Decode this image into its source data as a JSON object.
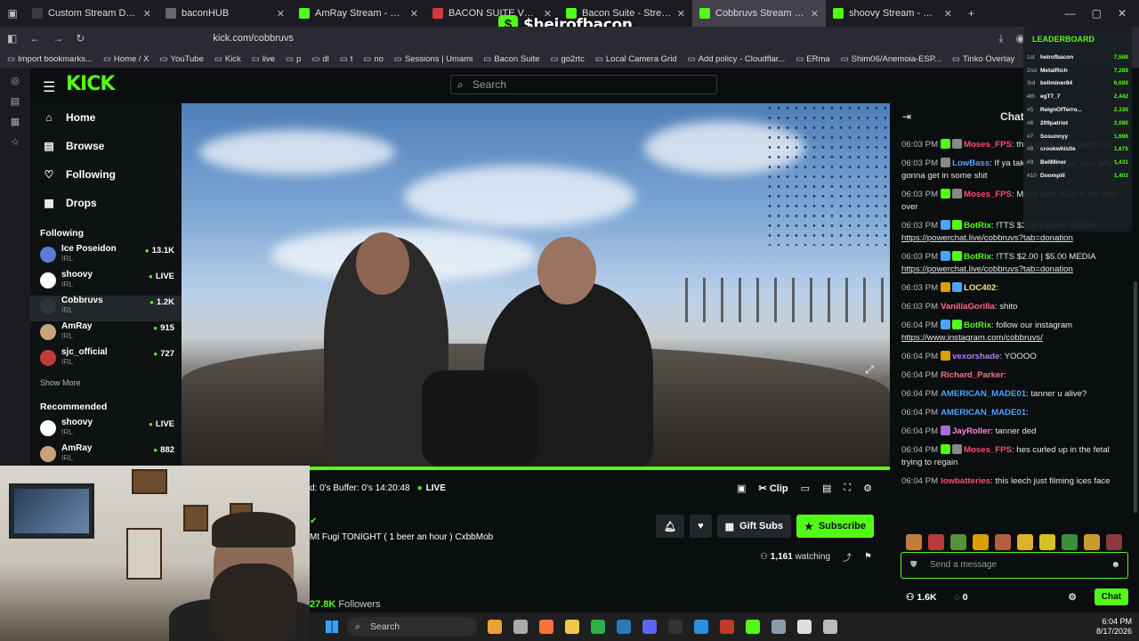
{
  "browser": {
    "tabs": [
      {
        "title": "Custom Stream Deck",
        "color": "#3b3a44"
      },
      {
        "title": "baconHUB",
        "color": "#666"
      },
      {
        "title": "AmRay Stream - Watch Live on",
        "color": "#53fc18"
      },
      {
        "title": "BACON SUITE V4 // COMMAND",
        "color": "#d23b3b"
      },
      {
        "title": "Bacon Suite - Stream - Watc",
        "color": "#53fc18"
      },
      {
        "title": "Cobbruvs Stream - Watch Live o",
        "color": "#53fc18"
      },
      {
        "title": "shoovy Stream - Watch Live on",
        "color": "#53fc18"
      }
    ],
    "url": "kick.com/cobbruvs",
    "bookmarks": [
      "Import bookmarks...",
      "Home / X",
      "YouTube",
      "Kick",
      "live",
      "p",
      "dl",
      "t",
      "no",
      "Sessions | Umami",
      "Bacon Suite",
      "go2rtc",
      "Local Camera Grid",
      "Add policy - Cloudflar...",
      "ERma",
      "Shim06/Anemoia-ESP...",
      "Tinko Overlay"
    ]
  },
  "overlay_brand": "$heirofbacon",
  "kick": {
    "logo": "KICK",
    "search_placeholder": "Search",
    "nav": [
      {
        "label": "Home",
        "icon": "home-icon",
        "glyph": "⌂"
      },
      {
        "label": "Browse",
        "icon": "browse-icon",
        "glyph": "▤"
      },
      {
        "label": "Following",
        "icon": "heart-icon",
        "glyph": "♡"
      },
      {
        "label": "Drops",
        "icon": "drops-icon",
        "glyph": "▦"
      }
    ],
    "following_title": "Following",
    "following": [
      {
        "name": "Ice Poseidon",
        "cat": "IRL",
        "count": "13.1K",
        "color": "#5a7bd6"
      },
      {
        "name": "shoovy",
        "cat": "IRL",
        "count": "LIVE",
        "color": "#ffffff"
      },
      {
        "name": "Cobbruvs",
        "cat": "IRL",
        "count": "1.2K",
        "color": "#333"
      },
      {
        "name": "AmRay",
        "cat": "IRL",
        "count": "915",
        "color": "#c9a27e"
      },
      {
        "name": "sjc_official",
        "cat": "IRL",
        "count": "727",
        "color": "#c23b3b"
      }
    ],
    "show_more": "Show More",
    "recommended_title": "Recommended",
    "recommended": [
      {
        "name": "shoovy",
        "cat": "IRL",
        "count": "LIVE",
        "color": "#ffffff"
      },
      {
        "name": "AmRay",
        "cat": "IRL",
        "count": "882",
        "color": "#c9a27e"
      }
    ]
  },
  "player": {
    "stats": "d: 0's  Buffer: 0's  14:20:48",
    "live": "LIVE",
    "clip": "Clip"
  },
  "stream": {
    "title": "Mt Fugi TONIGHT ( 1 beer an hour )  CxbbMob",
    "gift_subs": "Gift Subs",
    "subscribe": "Subscribe",
    "viewers": "1,161",
    "watching": "watching",
    "followers_count": "27.8K",
    "followers_label": "Followers"
  },
  "chat": {
    "title": "Chat",
    "messages": [
      {
        "time": "06:03 PM",
        "user": "Moses_FPS",
        "color": "#ff4d6d",
        "text": ": they gotta walk down too",
        "badges": [
          "#53fc18",
          "#888"
        ]
      },
      {
        "time": "06:03 PM",
        "user": "LowBass",
        "color": "#4da3ff",
        "text": ": If ya take it in the ass, your jelly's gonna get in some shit",
        "badges": [
          "#888"
        ]
      },
      {
        "time": "06:03 PM",
        "user": "Moses_FPS",
        "color": "#ff4d6d",
        "text": ": Might take 2026 is far from over",
        "badges": [
          "#53fc18",
          "#888"
        ]
      },
      {
        "time": "06:03 PM",
        "user": "BotRix",
        "color": "#53fc18",
        "text": ": !TTS $2.00 | $5.00 MEDIA ",
        "link": "https://powerchat.live/cobbruvs?tab=donation",
        "badges": [
          "#4da3ff",
          "#53fc18"
        ]
      },
      {
        "time": "06:03 PM",
        "user": "BotRix",
        "color": "#53fc18",
        "text": ": !TTS $2.00 | $5.00 MEDIA ",
        "link": "https://powerchat.live/cobbruvs?tab=donation",
        "badges": [
          "#4da3ff",
          "#53fc18"
        ]
      },
      {
        "time": "06:03 PM",
        "user": "LOC402",
        "color": "#f0e68c",
        "text": ":",
        "badges": [
          "#d8a000",
          "#4da3ff"
        ]
      },
      {
        "time": "06:03 PM",
        "user": "VanillaGorilla",
        "color": "#ff6b8b",
        "text": ": shito",
        "badges": []
      },
      {
        "time": "06:04 PM",
        "user": "BotRix",
        "color": "#53fc18",
        "text": ": follow our instagram ",
        "link": "https://www.instagram.com/cobbruvs/",
        "badges": [
          "#4da3ff",
          "#53fc18"
        ]
      },
      {
        "time": "06:04 PM",
        "user": "vexorshade",
        "color": "#b07cff",
        "text": ": YOOOO",
        "badges": [
          "#d8a000"
        ]
      },
      {
        "time": "06:04 PM",
        "user": "Richard_Parker",
        "color": "#ff6b8b",
        "text": ":",
        "badges": []
      },
      {
        "time": "06:04 PM",
        "user": "AMERICAN_MADE01",
        "color": "#4da3ff",
        "text": ": tanner u alive?",
        "badges": []
      },
      {
        "time": "06:04 PM",
        "user": "AMERICAN_MADE01",
        "color": "#4da3ff",
        "text": ":",
        "badges": []
      },
      {
        "time": "06:04 PM",
        "user": "JayRoller",
        "color": "#ff8ad6",
        "text": ": tanner ded",
        "badges": [
          "#a86bd8"
        ]
      },
      {
        "time": "06:04 PM",
        "user": "Moses_FPS",
        "color": "#ff4d6d",
        "text": ": hes curled up in the fetal trying to regain",
        "badges": [
          "#53fc18",
          "#888"
        ]
      },
      {
        "time": "06:04 PM",
        "user": "lowbatteries",
        "color": "#ff4d6d",
        "text": ": this leech just filming ices face",
        "badges": []
      }
    ],
    "input_placeholder": "Send a message",
    "footer_count": "1.6K",
    "footer_points": "0",
    "chat_button": "Chat"
  },
  "leaderboard": {
    "title": "LEADERBOARD",
    "rows": [
      {
        "rank": "1st",
        "name": "heirofbacon",
        "value": "7,588"
      },
      {
        "rank": "2nd",
        "name": "MetalRich",
        "value": "7,289"
      },
      {
        "rank": "3rd",
        "name": "bellminer84",
        "value": "6,689"
      },
      {
        "rank": "4th",
        "name": "egT7_7",
        "value": "2,442"
      },
      {
        "rank": "#5",
        "name": "ReignOfTerro...",
        "value": "2,336"
      },
      {
        "rank": "#6",
        "name": "209patriot",
        "value": "2,080"
      },
      {
        "rank": "#7",
        "name": "Sosunnyy",
        "value": "1,696"
      },
      {
        "rank": "#8",
        "name": "crookwhistle",
        "value": "1,675"
      },
      {
        "rank": "#9",
        "name": "BellMiner",
        "value": "1,431"
      },
      {
        "rank": "#10",
        "name": "Doompill",
        "value": "1,403"
      }
    ]
  },
  "taskbar": {
    "search": "Search",
    "time": "6:04 PM",
    "date": "8/17/2026"
  }
}
